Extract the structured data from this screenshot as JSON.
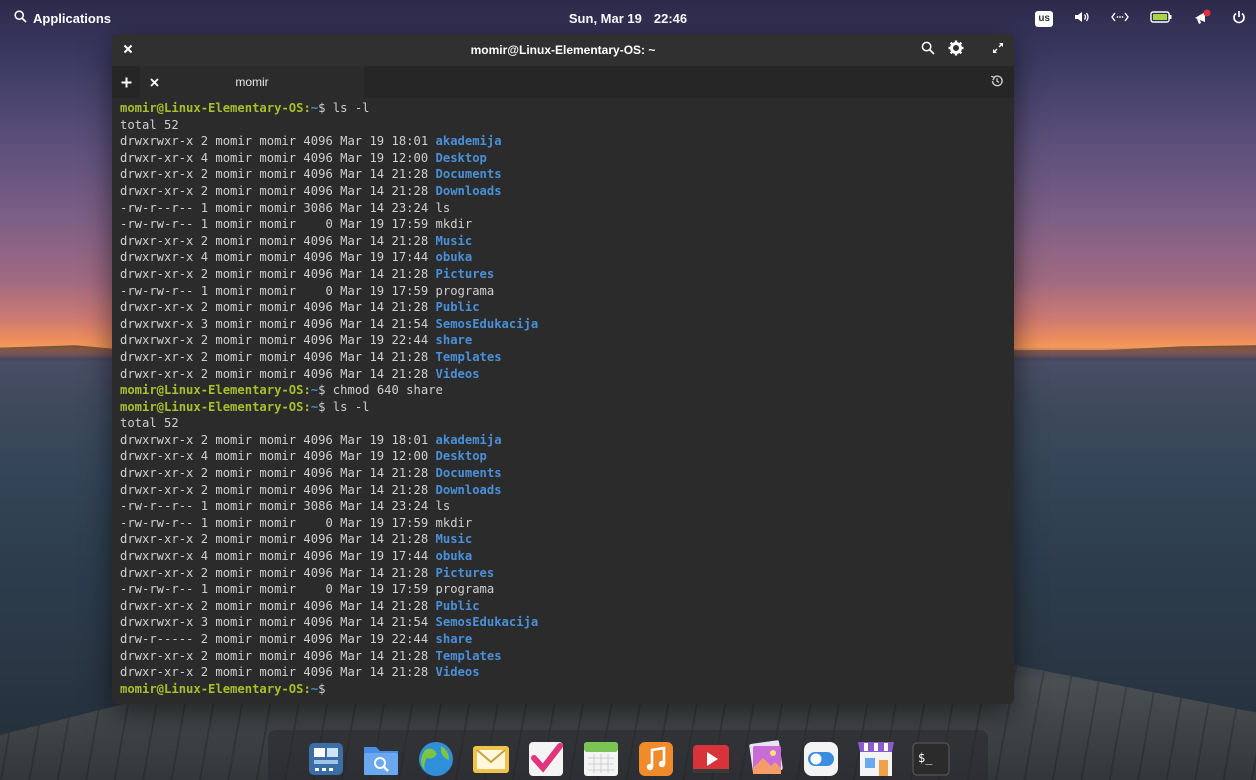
{
  "panel": {
    "applications_label": "Applications",
    "date": "Sun, Mar 19",
    "time": "22:46",
    "keyboard_layout": "us"
  },
  "window": {
    "title": "momir@Linux-Elementary-OS: ~",
    "tab_label": "momir"
  },
  "terminal": {
    "prompt_user": "momir@Linux-Elementary-OS",
    "prompt_path": "~",
    "lines": [
      {
        "kind": "cmd",
        "cmd": " ls -l"
      },
      {
        "kind": "text",
        "text": "total 52"
      },
      {
        "kind": "entry",
        "meta": "drwxrwxr-x 2 momir momir 4096 Mar 19 18:01 ",
        "name": "akademija",
        "dir": true
      },
      {
        "kind": "entry",
        "meta": "drwxr-xr-x 4 momir momir 4096 Mar 19 12:00 ",
        "name": "Desktop",
        "dir": true
      },
      {
        "kind": "entry",
        "meta": "drwxr-xr-x 2 momir momir 4096 Mar 14 21:28 ",
        "name": "Documents",
        "dir": true
      },
      {
        "kind": "entry",
        "meta": "drwxr-xr-x 2 momir momir 4096 Mar 14 21:28 ",
        "name": "Downloads",
        "dir": true
      },
      {
        "kind": "entry",
        "meta": "-rw-r--r-- 1 momir momir 3086 Mar 14 23:24 ",
        "name": "ls",
        "dir": false
      },
      {
        "kind": "entry",
        "meta": "-rw-rw-r-- 1 momir momir    0 Mar 19 17:59 ",
        "name": "mkdir",
        "dir": false
      },
      {
        "kind": "entry",
        "meta": "drwxr-xr-x 2 momir momir 4096 Mar 14 21:28 ",
        "name": "Music",
        "dir": true
      },
      {
        "kind": "entry",
        "meta": "drwxrwxr-x 4 momir momir 4096 Mar 19 17:44 ",
        "name": "obuka",
        "dir": true
      },
      {
        "kind": "entry",
        "meta": "drwxr-xr-x 2 momir momir 4096 Mar 14 21:28 ",
        "name": "Pictures",
        "dir": true
      },
      {
        "kind": "entry",
        "meta": "-rw-rw-r-- 1 momir momir    0 Mar 19 17:59 ",
        "name": "programa",
        "dir": false
      },
      {
        "kind": "entry",
        "meta": "drwxr-xr-x 2 momir momir 4096 Mar 14 21:28 ",
        "name": "Public",
        "dir": true
      },
      {
        "kind": "entry",
        "meta": "drwxrwxr-x 3 momir momir 4096 Mar 14 21:54 ",
        "name": "SemosEdukacija",
        "dir": true
      },
      {
        "kind": "entry",
        "meta": "drwxrwxr-x 2 momir momir 4096 Mar 19 22:44 ",
        "name": "share",
        "dir": true
      },
      {
        "kind": "entry",
        "meta": "drwxr-xr-x 2 momir momir 4096 Mar 14 21:28 ",
        "name": "Templates",
        "dir": true
      },
      {
        "kind": "entry",
        "meta": "drwxr-xr-x 2 momir momir 4096 Mar 14 21:28 ",
        "name": "Videos",
        "dir": true
      },
      {
        "kind": "cmd",
        "cmd": " chmod 640 share"
      },
      {
        "kind": "cmd",
        "cmd": " ls -l"
      },
      {
        "kind": "text",
        "text": "total 52"
      },
      {
        "kind": "entry",
        "meta": "drwxrwxr-x 2 momir momir 4096 Mar 19 18:01 ",
        "name": "akademija",
        "dir": true
      },
      {
        "kind": "entry",
        "meta": "drwxr-xr-x 4 momir momir 4096 Mar 19 12:00 ",
        "name": "Desktop",
        "dir": true
      },
      {
        "kind": "entry",
        "meta": "drwxr-xr-x 2 momir momir 4096 Mar 14 21:28 ",
        "name": "Documents",
        "dir": true
      },
      {
        "kind": "entry",
        "meta": "drwxr-xr-x 2 momir momir 4096 Mar 14 21:28 ",
        "name": "Downloads",
        "dir": true
      },
      {
        "kind": "entry",
        "meta": "-rw-r--r-- 1 momir momir 3086 Mar 14 23:24 ",
        "name": "ls",
        "dir": false
      },
      {
        "kind": "entry",
        "meta": "-rw-rw-r-- 1 momir momir    0 Mar 19 17:59 ",
        "name": "mkdir",
        "dir": false
      },
      {
        "kind": "entry",
        "meta": "drwxr-xr-x 2 momir momir 4096 Mar 14 21:28 ",
        "name": "Music",
        "dir": true
      },
      {
        "kind": "entry",
        "meta": "drwxrwxr-x 4 momir momir 4096 Mar 19 17:44 ",
        "name": "obuka",
        "dir": true
      },
      {
        "kind": "entry",
        "meta": "drwxr-xr-x 2 momir momir 4096 Mar 14 21:28 ",
        "name": "Pictures",
        "dir": true
      },
      {
        "kind": "entry",
        "meta": "-rw-rw-r-- 1 momir momir    0 Mar 19 17:59 ",
        "name": "programa",
        "dir": false
      },
      {
        "kind": "entry",
        "meta": "drwxr-xr-x 2 momir momir 4096 Mar 14 21:28 ",
        "name": "Public",
        "dir": true
      },
      {
        "kind": "entry",
        "meta": "drwxrwxr-x 3 momir momir 4096 Mar 14 21:54 ",
        "name": "SemosEdukacija",
        "dir": true
      },
      {
        "kind": "entry",
        "meta": "drw-r----- 2 momir momir 4096 Mar 19 22:44 ",
        "name": "share",
        "dir": true
      },
      {
        "kind": "entry",
        "meta": "drwxr-xr-x 2 momir momir 4096 Mar 14 21:28 ",
        "name": "Templates",
        "dir": true
      },
      {
        "kind": "entry",
        "meta": "drwxr-xr-x 2 momir momir 4096 Mar 14 21:28 ",
        "name": "Videos",
        "dir": true
      },
      {
        "kind": "cmd",
        "cmd": " "
      }
    ]
  },
  "dock": {
    "items": [
      {
        "name": "multitasking-view-icon",
        "color": "#3a6ea5"
      },
      {
        "name": "files-icon",
        "color": "#4a8fe7"
      },
      {
        "name": "web-browser-icon",
        "color": "#2f8fd8"
      },
      {
        "name": "mail-icon",
        "color": "#f0c44a"
      },
      {
        "name": "tasks-icon",
        "color": "#e0357c"
      },
      {
        "name": "calendar-icon",
        "color": "#7ac456"
      },
      {
        "name": "music-icon",
        "color": "#f08a2a"
      },
      {
        "name": "videos-icon",
        "color": "#d8323a"
      },
      {
        "name": "photos-icon",
        "color": "#c86dd7"
      },
      {
        "name": "settings-icon",
        "color": "#3c8ddf"
      },
      {
        "name": "appcenter-icon",
        "color": "#8a5cd0"
      },
      {
        "name": "terminal-icon",
        "color": "#2b2b2b"
      }
    ]
  }
}
